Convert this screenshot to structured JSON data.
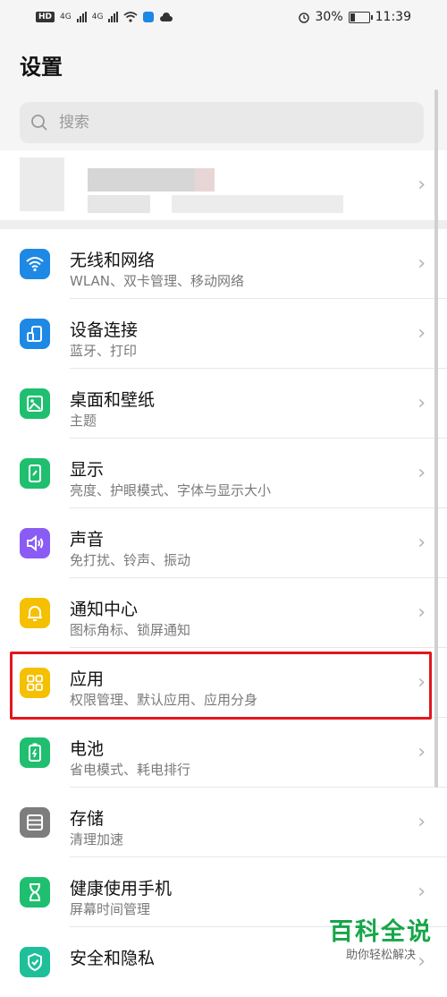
{
  "status_bar": {
    "left": {
      "hd": "HD",
      "net1": "4G",
      "net2": "4G"
    },
    "battery": "30%",
    "battery_level": 0.3,
    "time": "11:39"
  },
  "page": {
    "title": "设置"
  },
  "search": {
    "placeholder": "搜索"
  },
  "items": [
    {
      "title": "无线和网络",
      "subtitle": "WLAN、双卡管理、移动网络",
      "icon": "wifi-icon",
      "color": "#1e88e5"
    },
    {
      "title": "设备连接",
      "subtitle": "蓝牙、打印",
      "icon": "device-connection-icon",
      "color": "#1e88e5"
    },
    {
      "title": "桌面和壁纸",
      "subtitle": "主题",
      "icon": "wallpaper-icon",
      "color": "#1fbf6f"
    },
    {
      "title": "显示",
      "subtitle": "亮度、护眼模式、字体与显示大小",
      "icon": "display-icon",
      "color": "#1fbf6f"
    },
    {
      "title": "声音",
      "subtitle": "免打扰、铃声、振动",
      "icon": "sound-icon",
      "color": "#8a5cf5"
    },
    {
      "title": "通知中心",
      "subtitle": "图标角标、锁屏通知",
      "icon": "bell-icon",
      "color": "#f5c000"
    },
    {
      "title": "应用",
      "subtitle": "权限管理、默认应用、应用分身",
      "icon": "apps-icon",
      "color": "#f5c000"
    },
    {
      "title": "电池",
      "subtitle": "省电模式、耗电排行",
      "icon": "battery-icon",
      "color": "#1fbf6f"
    },
    {
      "title": "存储",
      "subtitle": "清理加速",
      "icon": "storage-icon",
      "color": "#7d7d7d"
    },
    {
      "title": "健康使用手机",
      "subtitle": "屏幕时间管理",
      "icon": "hourglass-icon",
      "color": "#1fbf6f"
    },
    {
      "title": "安全和隐私",
      "subtitle": "",
      "icon": "shield-icon",
      "color": "#1fbf9a"
    }
  ],
  "watermark": {
    "big": "百科全说",
    "small": "助你轻松解决"
  }
}
